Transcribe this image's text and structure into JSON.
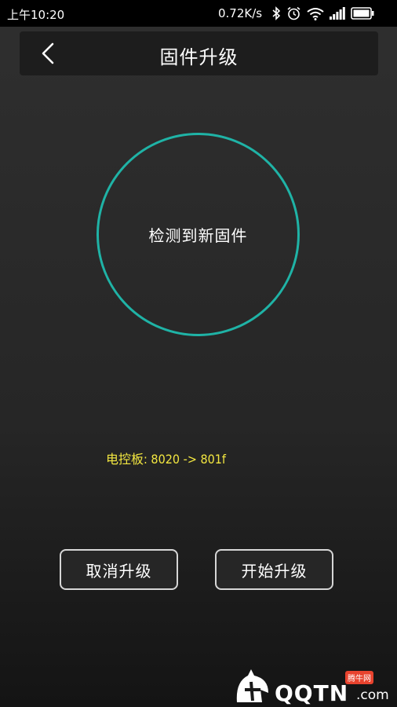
{
  "status_bar": {
    "time": "上午10:20",
    "net_speed": "0.72K/s",
    "icons": [
      "bluetooth-icon",
      "alarm-icon",
      "wifi-icon",
      "signal-icon",
      "battery-icon"
    ]
  },
  "header": {
    "title": "固件升级",
    "back_icon": "chevron-left-icon"
  },
  "status": {
    "message": "检测到新固件",
    "ring_color": "#1fb3a6"
  },
  "version": {
    "text": "电控板: 8020 -> 801f",
    "color": "#f2e640"
  },
  "actions": {
    "cancel_label": "取消升级",
    "start_label": "开始升级"
  },
  "watermark": {
    "brand": "QQTN",
    "suffix": ".com",
    "tag": "腾牛网"
  }
}
